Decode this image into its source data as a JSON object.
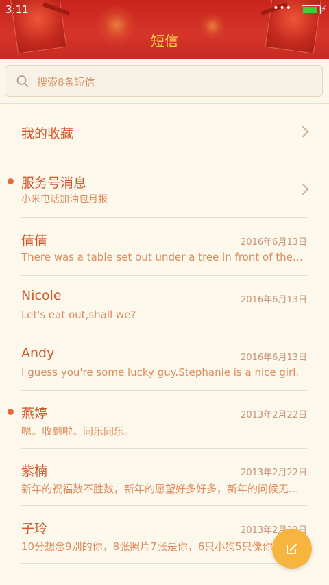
{
  "status_bar": {
    "time": "3:11",
    "indicators": "•••",
    "battery_color": "#35d335"
  },
  "header": {
    "title": "短信"
  },
  "search": {
    "placeholder": "搜索8条短信"
  },
  "favorites": {
    "label": "我的收藏"
  },
  "conversations": [
    {
      "name": "服务号消息",
      "snippet": "小米电话加油包月报",
      "date": "",
      "unread": true,
      "chevron": true
    },
    {
      "name": "倩倩",
      "snippet": "There was a table set out under a tree in front of the house",
      "date": "2016年6月13日",
      "unread": false,
      "chevron": false
    },
    {
      "name": "Nicole",
      "snippet": "Let's eat out,shall we?",
      "date": "2016年6月13日",
      "unread": false,
      "chevron": false
    },
    {
      "name": "Andy",
      "snippet": "I guess you're some lucky guy.Stephanie is a nice girl.",
      "date": "2016年6月13日",
      "unread": false,
      "chevron": false
    },
    {
      "name": "燕婷",
      "snippet": "嗯。收到啦。同乐同乐。",
      "date": "2013年2月22日",
      "unread": true,
      "chevron": false
    },
    {
      "name": "紫楠",
      "snippet": "新年的祝福数不胜数，新年的愿望好多好多，新年的问候无处不在",
      "date": "2013年2月22日",
      "unread": false,
      "chevron": false
    },
    {
      "name": "子玲",
      "snippet": "10分想念9别的你，8张照片7张是你，6只小狗5只像你",
      "date": "2013年2月22日",
      "unread": false,
      "chevron": false
    }
  ],
  "colors": {
    "header_red": "#c9241e",
    "title_gold": "#ffd24a",
    "name_orange": "#d2582d",
    "fab_yellow": "#f7b540"
  },
  "icons": {
    "search": "search-icon",
    "compose": "compose-icon",
    "chevron": "chevron-right-icon"
  }
}
